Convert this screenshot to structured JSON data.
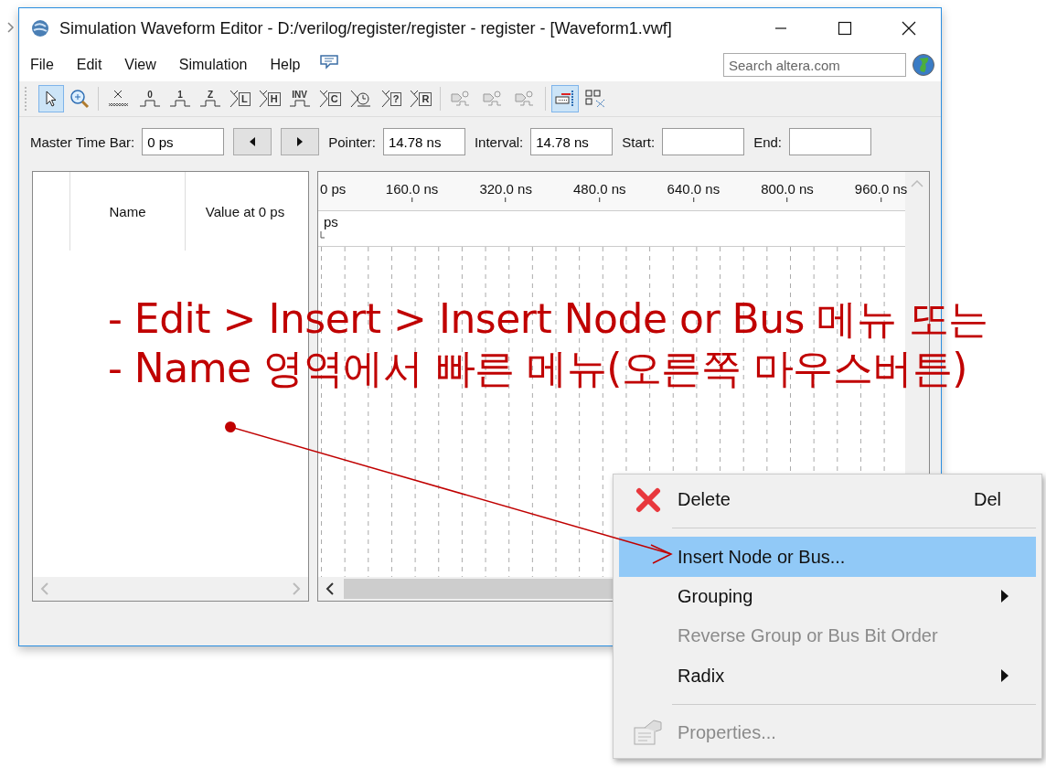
{
  "window": {
    "title": "Simulation Waveform Editor - D:/verilog/register/register - register - [Waveform1.vwf]"
  },
  "menu": [
    "File",
    "Edit",
    "View",
    "Simulation",
    "Help"
  ],
  "search": {
    "placeholder": "Search altera.com"
  },
  "toolbar": [
    {
      "kind": "pointer",
      "selected": true
    },
    {
      "kind": "zoom",
      "selected": false
    },
    {
      "kind": "separator"
    },
    {
      "kind": "unknown",
      "selected": false
    },
    {
      "kind": "level",
      "glyph": "0",
      "selected": false
    },
    {
      "kind": "level",
      "glyph": "1",
      "selected": false
    },
    {
      "kind": "level",
      "glyph": "Z",
      "selected": false
    },
    {
      "kind": "weak",
      "glyph": "L",
      "selected": false
    },
    {
      "kind": "weak",
      "glyph": "H",
      "selected": false
    },
    {
      "kind": "level",
      "glyph": "INV",
      "selected": false
    },
    {
      "kind": "weak",
      "glyph": "C",
      "selected": false
    },
    {
      "kind": "clock",
      "selected": false
    },
    {
      "kind": "weak",
      "glyph": "?",
      "selected": false
    },
    {
      "kind": "weak",
      "glyph": "R",
      "selected": false
    },
    {
      "kind": "separator"
    },
    {
      "kind": "sim",
      "selected": false
    },
    {
      "kind": "sim",
      "selected": false
    },
    {
      "kind": "sim",
      "selected": false
    },
    {
      "kind": "separator"
    },
    {
      "kind": "snap",
      "selected": true
    },
    {
      "kind": "grid",
      "selected": false
    }
  ],
  "time_bar": {
    "master_label": "Master Time Bar:",
    "master_value": "0 ps",
    "pointer_label": "Pointer:",
    "pointer_value": "14.78 ns",
    "interval_label": "Interval:",
    "interval_value": "14.78 ns",
    "start_label": "Start:",
    "end_label": "End:"
  },
  "node_list": {
    "columns": [
      "Name",
      "Value at 0 ps"
    ]
  },
  "waveform": {
    "ticks": [
      "0 ps",
      "160.0 ns",
      "320.0 ns",
      "480.0 ns",
      "640.0 ns",
      "800.0 ns",
      "960.0 ns"
    ],
    "cursor_label": "ps"
  },
  "annotation": {
    "lines": [
      "- Edit > Insert > Insert Node or Bus 메뉴 또는",
      "- Name 영역에서 빠른 메뉴(오른쪽 마우스버튼)"
    ]
  },
  "context_menu": {
    "items": [
      {
        "kind": "delete",
        "label": "Delete",
        "shortcut": "Del",
        "selected": false,
        "disabled": false,
        "submenu": false
      },
      {
        "kind": "separator"
      },
      {
        "kind": "plain",
        "label": "Insert Node or Bus...",
        "selected": true,
        "disabled": false,
        "submenu": false
      },
      {
        "kind": "plain",
        "label": "Grouping",
        "selected": false,
        "disabled": false,
        "submenu": true
      },
      {
        "kind": "plain",
        "label": "Reverse Group or Bus Bit Order",
        "selected": false,
        "disabled": true,
        "submenu": false
      },
      {
        "kind": "plain",
        "label": "Radix",
        "selected": false,
        "disabled": false,
        "submenu": true
      },
      {
        "kind": "separator"
      },
      {
        "kind": "properties",
        "label": "Properties...",
        "selected": false,
        "disabled": true,
        "submenu": false
      }
    ]
  }
}
